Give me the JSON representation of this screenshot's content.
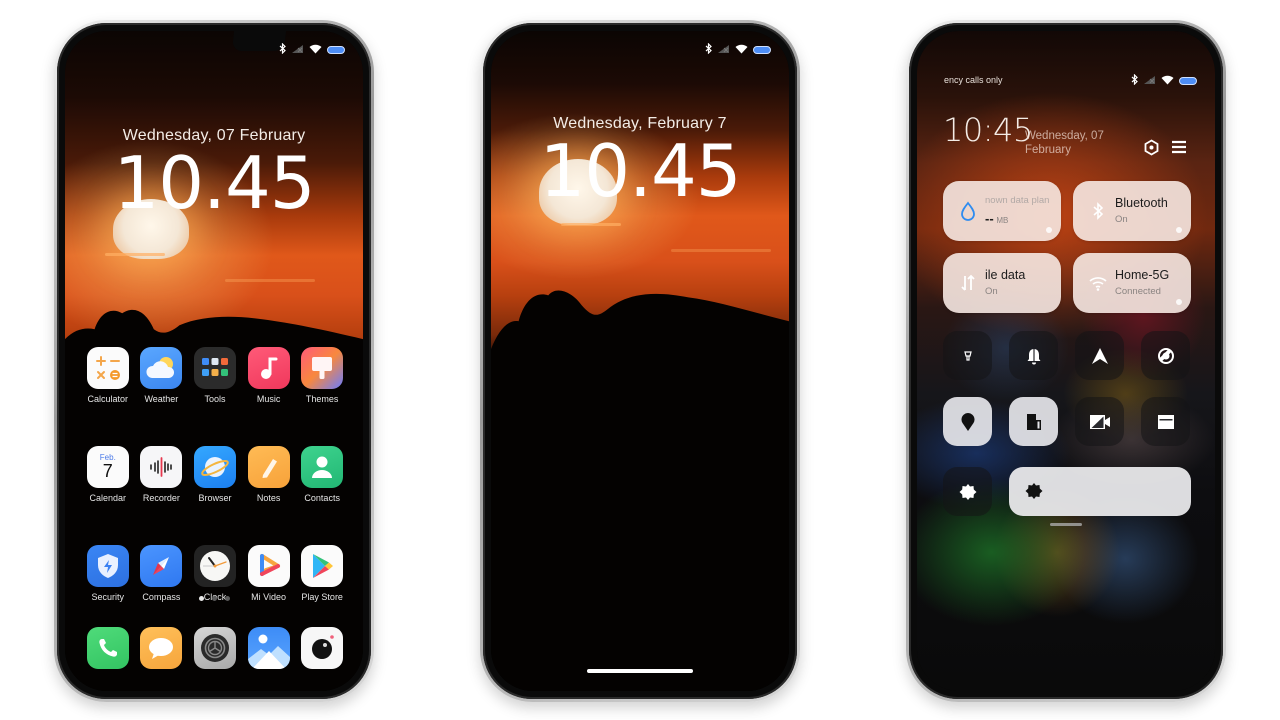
{
  "phones": {
    "home": {
      "status": {
        "icons": [
          "bluetooth-icon",
          "signal-off-icon",
          "wifi-icon",
          "battery-icon"
        ]
      },
      "date": "Wednesday, 07 February",
      "time": "10.45",
      "apps": [
        {
          "label": "Calculator",
          "icon": "calculator-icon"
        },
        {
          "label": "Weather",
          "icon": "weather-icon"
        },
        {
          "label": "Tools",
          "icon": "tools-folder-icon"
        },
        {
          "label": "Music",
          "icon": "music-icon"
        },
        {
          "label": "Themes",
          "icon": "themes-icon"
        },
        {
          "label": "Calendar",
          "icon": "calendar-icon",
          "month": "Feb.",
          "day": "7"
        },
        {
          "label": "Recorder",
          "icon": "recorder-icon"
        },
        {
          "label": "Browser",
          "icon": "browser-icon"
        },
        {
          "label": "Notes",
          "icon": "notes-icon"
        },
        {
          "label": "Contacts",
          "icon": "contacts-icon"
        },
        {
          "label": "Security",
          "icon": "security-icon"
        },
        {
          "label": "Compass",
          "icon": "compass-icon"
        },
        {
          "label": "Clock",
          "icon": "clock-icon"
        },
        {
          "label": "Mi Video",
          "icon": "mi-video-icon"
        },
        {
          "label": "Play Store",
          "icon": "play-store-icon"
        }
      ],
      "page_dots": {
        "count": 3,
        "active": 0
      },
      "dock": [
        {
          "icon": "phone-icon"
        },
        {
          "icon": "messages-icon"
        },
        {
          "icon": "settings-icon"
        },
        {
          "icon": "gallery-icon"
        },
        {
          "icon": "camera-icon"
        }
      ]
    },
    "lock": {
      "status": {
        "icons": [
          "bluetooth-icon",
          "signal-off-icon",
          "wifi-icon",
          "battery-icon"
        ]
      },
      "date": "Wednesday,  February 7",
      "time": "10.45"
    },
    "control_center": {
      "carrier": "ency calls only",
      "time": "10:45",
      "date_line1": "Wednesday, 07",
      "date_line2": "February",
      "tiles": [
        {
          "title": "nown data plan",
          "value": "--",
          "unit": "MB",
          "icon": "data-drop-icon"
        },
        {
          "title": "Bluetooth",
          "sub": "On",
          "icon": "bluetooth-icon"
        },
        {
          "title": "ile data",
          "sub": "On",
          "icon": "mobile-data-icon"
        },
        {
          "title": "Home-5G",
          "sub": "Connected",
          "icon": "wifi-icon"
        }
      ],
      "toggles": [
        {
          "icon": "flashlight-icon",
          "on": false
        },
        {
          "icon": "bell-icon",
          "on": false
        },
        {
          "icon": "airplane-icon",
          "on": false
        },
        {
          "icon": "auto-rotate-icon",
          "on": false
        },
        {
          "icon": "location-icon",
          "on": true
        },
        {
          "icon": "screen-cast-icon",
          "on": true
        },
        {
          "icon": "screen-recorder-icon",
          "on": false
        },
        {
          "icon": "reading-mode-icon",
          "on": false
        }
      ],
      "accent": "#4d8df6"
    }
  }
}
